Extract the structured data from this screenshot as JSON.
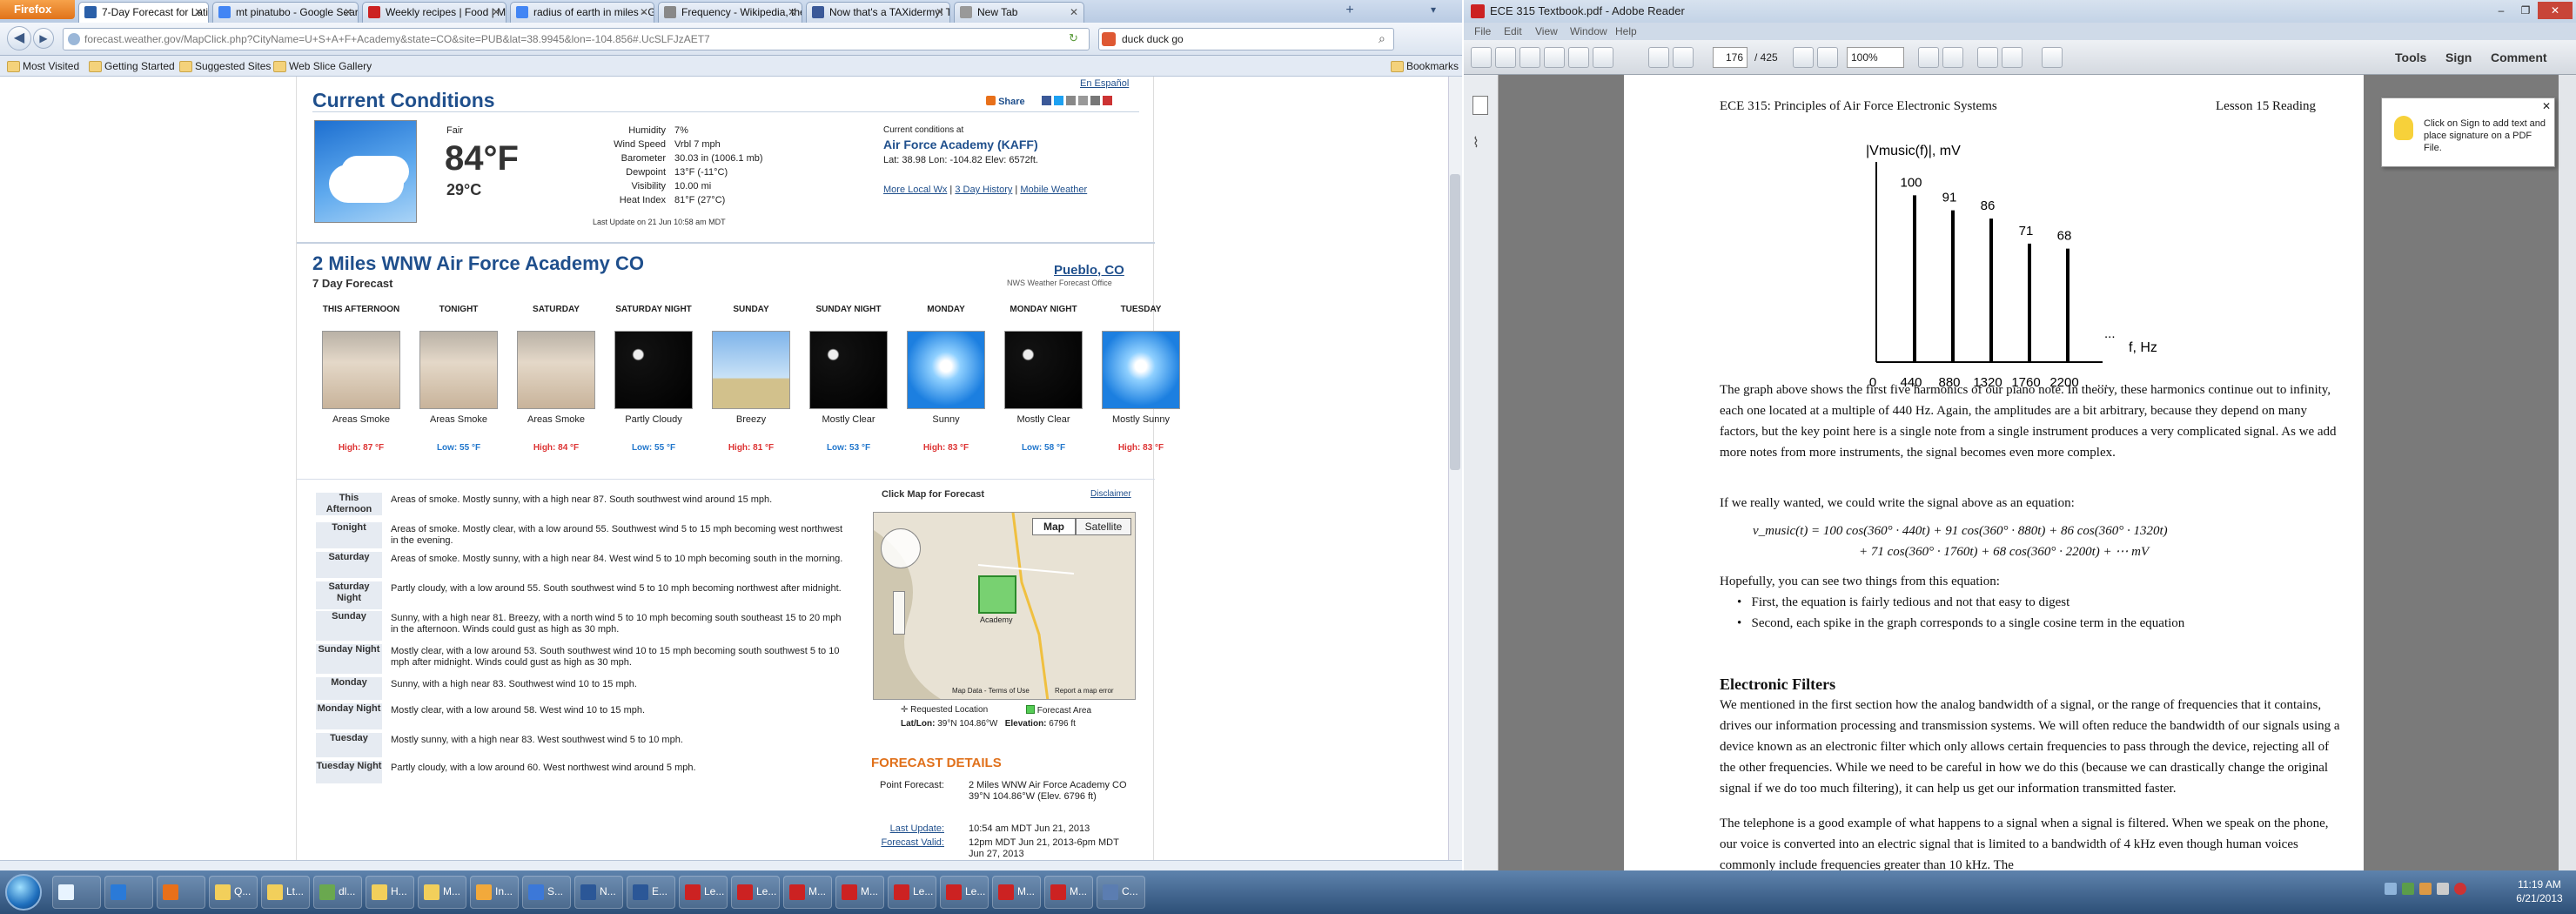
{
  "firefox": {
    "menu_label": "Firefox",
    "tabs": [
      {
        "label": "7-Day Forecast for Latitude 3...",
        "color": "#2a5fa8",
        "active": true
      },
      {
        "label": "mt pinatubo - Google Search",
        "color": "#4285f4"
      },
      {
        "label": "Weekly recipes | Food | Mac...",
        "color": "#cc2222"
      },
      {
        "label": "radius of earth in miles - Go...",
        "color": "#4285f4"
      },
      {
        "label": "Frequency - Wikipedia, the fr...",
        "color": "#888888"
      },
      {
        "label": "Now that's a TAXidermy! Th...",
        "color": "#3b5998"
      },
      {
        "label": "New Tab",
        "color": "#999999"
      }
    ],
    "url": "forecast.weather.gov/MapClick.php?CityName=U+S+A+F+Academy&state=CO&site=PUB&lat=38.9945&lon=-104.856#.UcSLFJzAET7",
    "search_value": "duck duck go",
    "bookmarks": [
      "Most Visited",
      "Getting Started",
      "Suggested Sites",
      "Web Slice Gallery"
    ],
    "bookmarks_right": "Bookmarks"
  },
  "weather": {
    "en_espanol": "En Español",
    "current_title": "Current Conditions",
    "share_label": "Share",
    "condition": "Fair",
    "temp_f": "84°F",
    "temp_c": "29°C",
    "details": [
      {
        "label": "Humidity",
        "value": "7%"
      },
      {
        "label": "Wind Speed",
        "value": "Vrbl 7 mph"
      },
      {
        "label": "Barometer",
        "value": "30.03 in (1006.1 mb)"
      },
      {
        "label": "Dewpoint",
        "value": "13°F (-11°C)"
      },
      {
        "label": "Visibility",
        "value": "10.00 mi"
      },
      {
        "label": "Heat Index",
        "value": "81°F (27°C)"
      }
    ],
    "last_update": "Last Update on 21 Jun 10:58 am MDT",
    "conditions_at": "Current conditions at",
    "station": "Air Force Academy (KAFF)",
    "latlon": "Lat: 38.98 Lon: -104.82 Elev: 6572ft.",
    "links": [
      "More Local Wx",
      "3 Day History",
      "Mobile Weather"
    ],
    "forecast_title": "2 Miles WNW Air Force Academy CO",
    "forecast_sub": "7 Day Forecast",
    "office_link": "Pueblo, CO",
    "office_sub": "NWS Weather Forecast Office",
    "days": [
      {
        "name": "THIS AFTERNOON",
        "cap": "Areas Smoke",
        "temp": "High: 87 °F",
        "kind": "hi",
        "sky": "smoke"
      },
      {
        "name": "TONIGHT",
        "cap": "Areas Smoke",
        "temp": "Low: 55 °F",
        "kind": "lo",
        "sky": "smoke"
      },
      {
        "name": "SATURDAY",
        "cap": "Areas Smoke",
        "temp": "High: 84 °F",
        "kind": "hi",
        "sky": "smoke"
      },
      {
        "name": "SATURDAY NIGHT",
        "cap": "Partly Cloudy",
        "temp": "Low: 55 °F",
        "kind": "lo",
        "sky": "night"
      },
      {
        "name": "SUNDAY",
        "cap": "Breezy",
        "temp": "High: 81 °F",
        "kind": "hi",
        "sky": "wind"
      },
      {
        "name": "SUNDAY NIGHT",
        "cap": "Mostly Clear",
        "temp": "Low: 53 °F",
        "kind": "lo",
        "sky": "night"
      },
      {
        "name": "MONDAY",
        "cap": "Sunny",
        "temp": "High: 83 °F",
        "kind": "hi",
        "sky": "sun"
      },
      {
        "name": "MONDAY NIGHT",
        "cap": "Mostly Clear",
        "temp": "Low: 58 °F",
        "kind": "lo",
        "sky": "night"
      },
      {
        "name": "TUESDAY",
        "cap": "Mostly Sunny",
        "temp": "High: 83 °F",
        "kind": "hi",
        "sky": "sun"
      }
    ],
    "detailed": [
      {
        "period": "This Afternoon",
        "text": "Areas of smoke. Mostly sunny, with a high near 87. South southwest wind around 15 mph."
      },
      {
        "period": "Tonight",
        "text": "Areas of smoke. Mostly clear, with a low around 55. Southwest wind 5 to 15 mph becoming west northwest in the evening."
      },
      {
        "period": "Saturday",
        "text": "Areas of smoke. Mostly sunny, with a high near 84. West wind 5 to 10 mph becoming south in the morning."
      },
      {
        "period": "Saturday Night",
        "text": "Partly cloudy, with a low around 55. South southwest wind 5 to 10 mph becoming northwest after midnight."
      },
      {
        "period": "Sunday",
        "text": "Sunny, with a high near 81. Breezy, with a north wind 5 to 10 mph becoming south southeast 15 to 20 mph in the afternoon. Winds could gust as high as 30 mph."
      },
      {
        "period": "Sunday Night",
        "text": "Mostly clear, with a low around 53. South southwest wind 10 to 15 mph becoming south southwest 5 to 10 mph after midnight. Winds could gust as high as 30 mph."
      },
      {
        "period": "Monday",
        "text": "Sunny, with a high near 83. Southwest wind 10 to 15 mph."
      },
      {
        "period": "Monday Night",
        "text": "Mostly clear, with a low around 58. West wind 10 to 15 mph."
      },
      {
        "period": "Tuesday",
        "text": "Mostly sunny, with a high near 83. West southwest wind 5 to 10 mph."
      },
      {
        "period": "Tuesday Night",
        "text": "Partly cloudy, with a low around 60. West northwest wind around 5 mph."
      }
    ],
    "map_title": "Click Map for Forecast",
    "disclaimer": "Disclaimer",
    "map_btn": "Map",
    "sat_btn": "Satellite",
    "map_label_academy": "Academy",
    "map_data": "Map Data",
    "map_terms": "Terms of Use",
    "map_report": "Report a map error",
    "legend_req": "Requested Location",
    "legend_area": "Forecast Area",
    "latlon_label": "Lat/Lon:",
    "latlon_value": "39°N 104.86°W",
    "elev_label": "Elevation:",
    "elev_value": "6796 ft",
    "fd_title": "FORECAST DETAILS",
    "fd_point_label": "Point Forecast:",
    "fd_point_value": "2 Miles WNW Air Force Academy CO 39°N 104.86°W (Elev. 6796 ft)",
    "fd_update_label": "Last Update:",
    "fd_update_value": "10:54 am MDT Jun 21, 2013",
    "fd_valid_label": "Forecast Valid:",
    "fd_valid_value": "12pm MDT Jun 21, 2013-6pm MDT Jun 27, 2013"
  },
  "reader": {
    "title": "ECE 315 Textbook.pdf - Adobe Reader",
    "menu": [
      "File",
      "Edit",
      "View",
      "Window",
      "Help"
    ],
    "page_num": "176",
    "page_total": "/ 425",
    "zoom": "100%",
    "tools_btn": "Tools",
    "sign_btn": "Sign",
    "comment_btn": "Comment",
    "hint": "Click on Sign to add text and place signature on a PDF File.",
    "header_left": "ECE 315: Principles of Air Force Electronic Systems",
    "header_right": "Lesson 15 Reading",
    "p1": "The graph above shows the first five harmonics of our piano note.  In theory, these harmonics continue out to infinity, each one located at a multiple of 440 Hz.  Again, the amplitudes are a bit arbitrary, because they depend on many factors, but the key point here is a single note from a single instrument produces a very complicated signal.  As we add more notes from more instruments, the signal becomes even more complex.",
    "p2": "If we really wanted, we could write the signal above as an equation:",
    "eq1": "v_music(t) = 100 cos(360° ∙ 440t) + 91 cos(360° ∙ 880t) + 86 cos(360° ∙ 1320t)",
    "eq2": "+ 71 cos(360° ∙ 1760t) + 68 cos(360° ∙ 2200t) + ⋯  mV",
    "p3": "Hopefully, you can see two things from this equation:",
    "bullets": [
      "First, the equation is fairly tedious and not that easy to digest",
      "Second, each spike in the graph corresponds to a single cosine term in the equation"
    ],
    "h_filters": "Electronic Filters",
    "p4": "We mentioned in the first section how the analog bandwidth of a signal, or the range of frequencies that it contains, drives our information processing and transmission systems.  We will often reduce the bandwidth of our signals using a device known as an electronic filter which only allows certain frequencies to pass through the device, rejecting all of the other frequencies.  While we need to be careful in how we do this (because we can drastically change the original signal if we do too much filtering), it can help us get our information transmitted faster.",
    "p5": "The telephone is a good example of what happens to a signal when a signal is filtered.  When we speak on the phone, our voice is converted into an electric signal that is limited to a bandwidth of 4 kHz even though human voices commonly include frequencies greater than 10 kHz.  The"
  },
  "chart_data": {
    "type": "bar",
    "ylabel": "|Vmusic(f)|, mV",
    "xlabel": "f, Hz",
    "categories": [
      "440",
      "880",
      "1320",
      "1760",
      "2200"
    ],
    "values": [
      100,
      91,
      86,
      71,
      68
    ],
    "x_ticks": [
      "0",
      "440",
      "880",
      "1320",
      "1760",
      "2200",
      "..."
    ],
    "ylim": [
      0,
      120
    ]
  },
  "taskbar": {
    "clock_time": "11:19 AM",
    "clock_date": "6/21/2013",
    "buttons": [
      {
        "label": "",
        "color": "#e8f4ff"
      },
      {
        "label": "",
        "color": "#2a7ad8"
      },
      {
        "label": "",
        "color": "#e8701a"
      },
      {
        "label": "Q...",
        "color": "#f2cf5b"
      },
      {
        "label": "Lt...",
        "color": "#f2cf5b"
      },
      {
        "label": "dl...",
        "color": "#6aa84f"
      },
      {
        "label": "H...",
        "color": "#f2cf5b"
      },
      {
        "label": "M...",
        "color": "#f2cf5b"
      },
      {
        "label": "In...",
        "color": "#f2a93b"
      },
      {
        "label": "S...",
        "color": "#3c78d8"
      },
      {
        "label": "N...",
        "color": "#2b5797"
      },
      {
        "label": "E...",
        "color": "#2b5797"
      },
      {
        "label": "Le...",
        "color": "#cc2222"
      },
      {
        "label": "Le...",
        "color": "#cc2222"
      },
      {
        "label": "M...",
        "color": "#cc2222"
      },
      {
        "label": "M...",
        "color": "#cc2222"
      },
      {
        "label": "Le...",
        "color": "#cc2222"
      },
      {
        "label": "Le...",
        "color": "#cc2222"
      },
      {
        "label": "M...",
        "color": "#cc2222"
      },
      {
        "label": "M...",
        "color": "#cc2222"
      },
      {
        "label": "C...",
        "color": "#5b7db1"
      }
    ]
  }
}
